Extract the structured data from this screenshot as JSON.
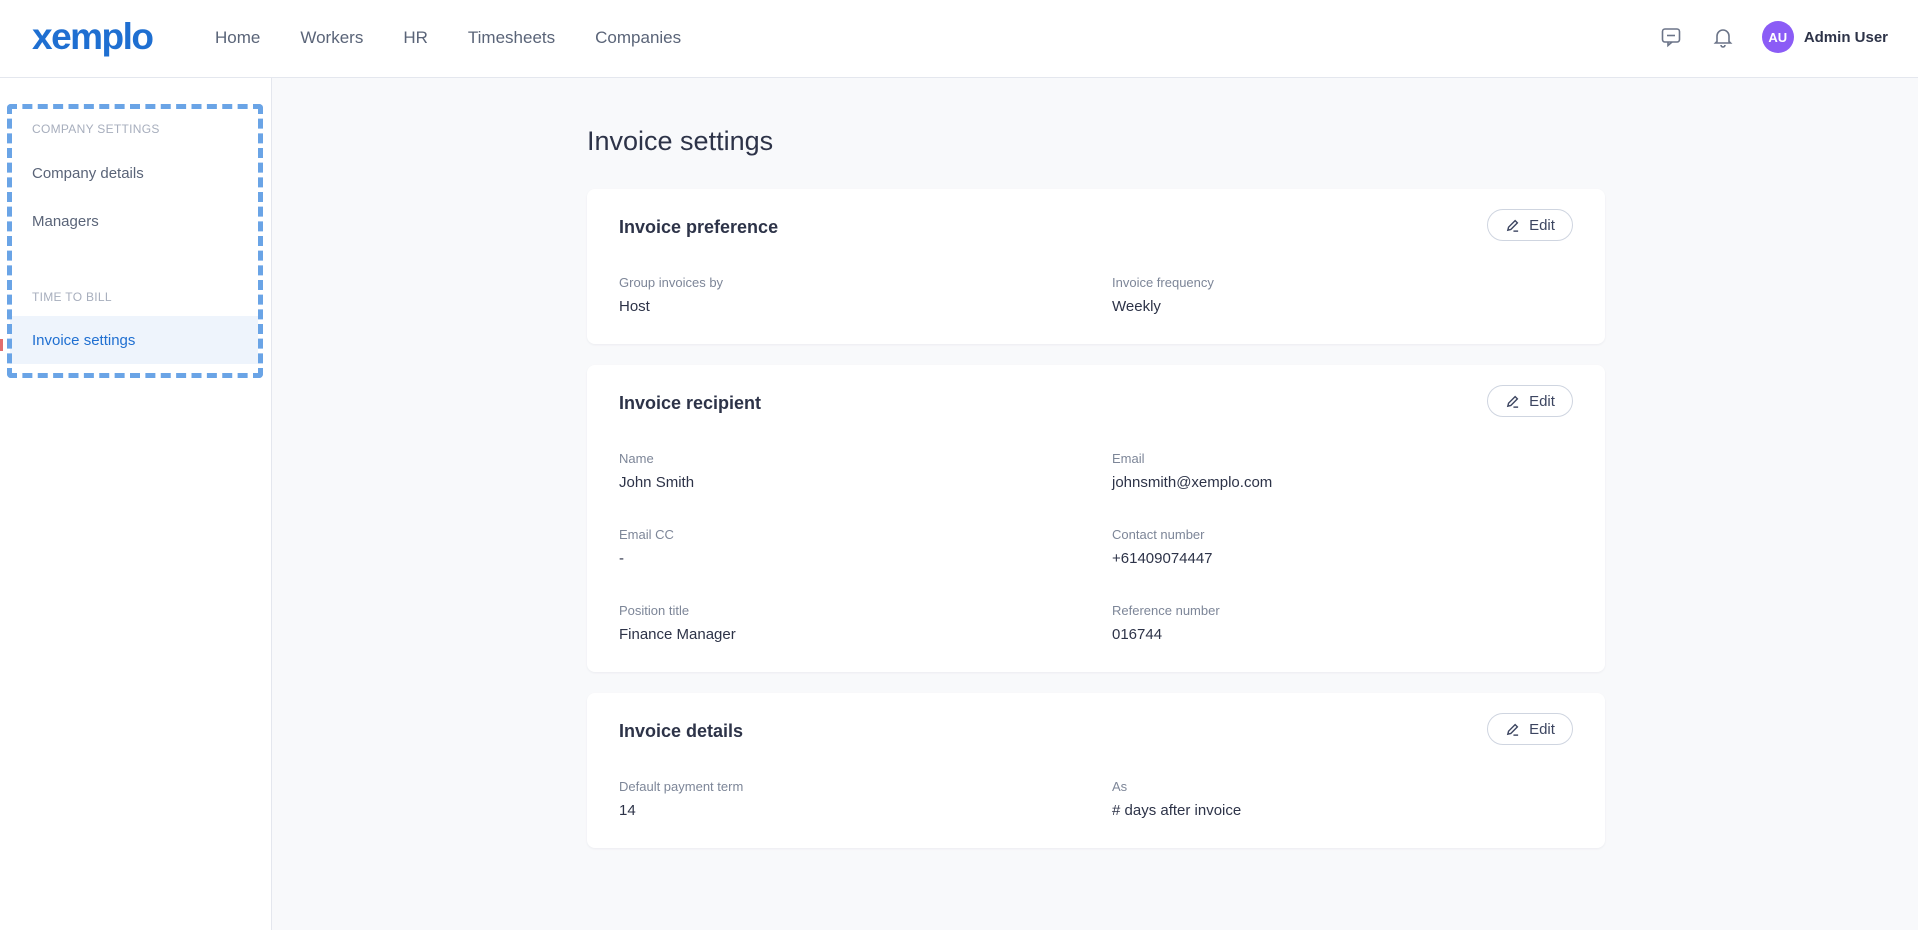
{
  "header": {
    "logo": "xemplo",
    "nav": [
      "Home",
      "Workers",
      "HR",
      "Timesheets",
      "Companies"
    ],
    "user": {
      "initials": "AU",
      "name": "Admin User",
      "avatar_color": "#8b5cf6"
    },
    "icons": [
      "chat-icon",
      "bell-icon"
    ]
  },
  "sidebar": {
    "sections": [
      {
        "label": "COMPANY SETTINGS",
        "items": [
          "Company details",
          "Managers"
        ]
      },
      {
        "label": "TIME TO BILL",
        "items": [
          "Invoice settings"
        ]
      }
    ],
    "active_item": "Invoice settings"
  },
  "page": {
    "title": "Invoice settings",
    "edit_label": "Edit",
    "cards": [
      {
        "title": "Invoice preference",
        "fields": [
          {
            "label": "Group invoices by",
            "value": "Host"
          },
          {
            "label": "Invoice frequency",
            "value": "Weekly"
          }
        ]
      },
      {
        "title": "Invoice recipient",
        "fields": [
          {
            "label": "Name",
            "value": "John Smith"
          },
          {
            "label": "Email",
            "value": "johnsmith@xemplo.com"
          },
          {
            "label": "Email CC",
            "value": "-"
          },
          {
            "label": "Contact number",
            "value": "+61409074447"
          },
          {
            "label": "Position title",
            "value": "Finance Manager"
          },
          {
            "label": "Reference number",
            "value": "016744"
          }
        ]
      },
      {
        "title": "Invoice details",
        "fields": [
          {
            "label": "Default payment term",
            "value": "14"
          },
          {
            "label": "As",
            "value": "# days after invoice"
          }
        ]
      }
    ]
  },
  "colors": {
    "brand": "#1f6fd1",
    "active_bg": "#eef4fc",
    "focus_outline": "#6aa4e6"
  }
}
